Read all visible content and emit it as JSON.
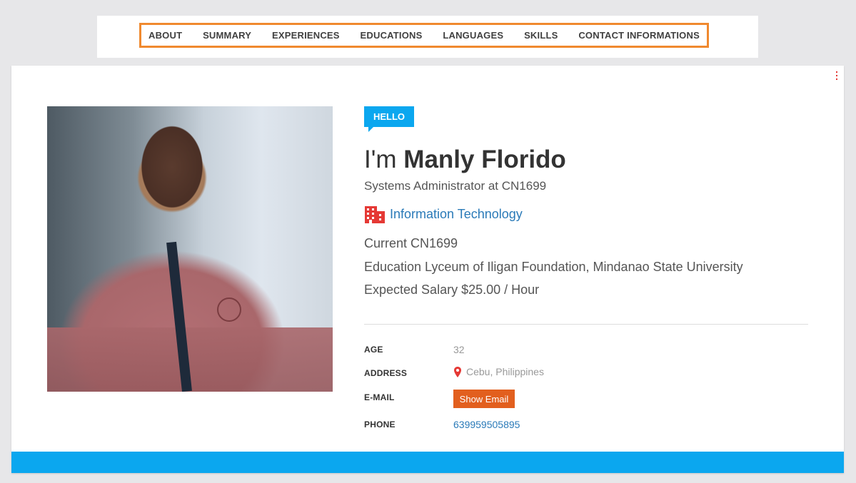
{
  "nav": {
    "items": [
      {
        "label": "ABOUT"
      },
      {
        "label": "SUMMARY"
      },
      {
        "label": "EXPERIENCES"
      },
      {
        "label": "EDUCATIONS"
      },
      {
        "label": "LANGUAGES"
      },
      {
        "label": "SKILLS"
      },
      {
        "label": "CONTACT INFORMATIONS"
      }
    ]
  },
  "profile": {
    "badge": "HELLO",
    "intro_prefix": "I'm ",
    "name": "Manly Florido",
    "title": "Systems Administrator at CN1699",
    "industry": "Information Technology",
    "current": "Current CN1699",
    "education": "Education Lyceum of Iligan Foundation, Mindanao State University",
    "expected_salary": "Expected Salary $25.00 / Hour"
  },
  "details": {
    "age_label": "AGE",
    "age_value": "32",
    "address_label": "ADDRESS",
    "address_value": "Cebu, Philippines",
    "email_label": "E-MAIL",
    "email_button": "Show Email",
    "phone_label": "PHONE",
    "phone_value": "639959505895"
  },
  "colors": {
    "accent": "#0ba7ef",
    "nav_border": "#f0892e",
    "button": "#e25f1e",
    "link": "#2a7ab8",
    "icon_red": "#e53935"
  },
  "icons": {
    "industry": "building-icon",
    "address": "map-pin-icon",
    "menu": "vertical-dots-icon"
  }
}
